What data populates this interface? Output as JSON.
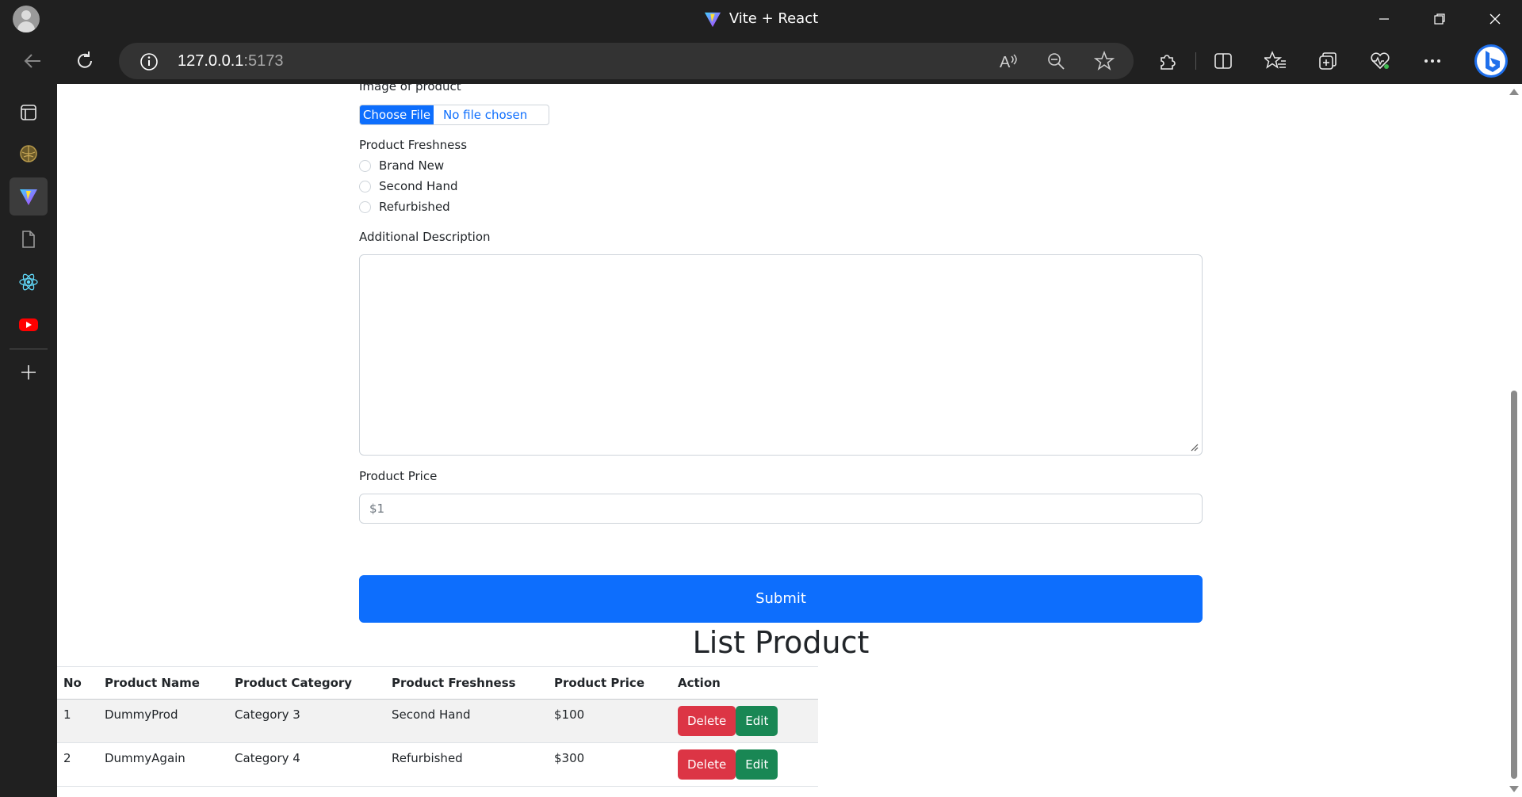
{
  "window": {
    "title": "Vite + React",
    "controls": [
      "minimize",
      "restore",
      "close"
    ]
  },
  "browser": {
    "url_host": "127.0.0.1",
    "url_port": ":5173",
    "icons": [
      "back-icon",
      "refresh-icon",
      "site-info-icon",
      "read-aloud-icon",
      "zoom-out-icon",
      "favorite-star-icon",
      "extensions-icon",
      "split-screen-icon",
      "favorites-icon",
      "collections-icon",
      "health-icon",
      "more-icon",
      "bing-copilot-icon"
    ]
  },
  "sidebar": {
    "items": [
      "tabs-icon",
      "globe-app-icon",
      "vite-tab-icon",
      "document-icon",
      "react-icon",
      "youtube-icon",
      "add-icon"
    ]
  },
  "form": {
    "image_label": "Image of product",
    "choose_file": "Choose File",
    "no_file": "No file chosen",
    "freshness_label": "Product Freshness",
    "freshness_options": [
      "Brand New",
      "Second Hand",
      "Refurbished"
    ],
    "description_label": "Additional Description",
    "description_value": "",
    "price_label": "Product Price",
    "price_placeholder": "$1",
    "submit_label": "Submit"
  },
  "list": {
    "title": "List Product",
    "columns": [
      "No",
      "Product Name",
      "Product Category",
      "Product Freshness",
      "Product Price",
      "Action"
    ],
    "rows": [
      {
        "no": "1",
        "name": "DummyProd",
        "category": "Category 3",
        "freshness": "Second Hand",
        "price": "$100"
      },
      {
        "no": "2",
        "name": "DummyAgain",
        "category": "Category 4",
        "freshness": "Refurbished",
        "price": "$300"
      }
    ],
    "delete_label": "Delete",
    "edit_label": "Edit"
  },
  "colors": {
    "primary": "#0d6efd",
    "danger": "#dc3545",
    "success": "#198754"
  }
}
